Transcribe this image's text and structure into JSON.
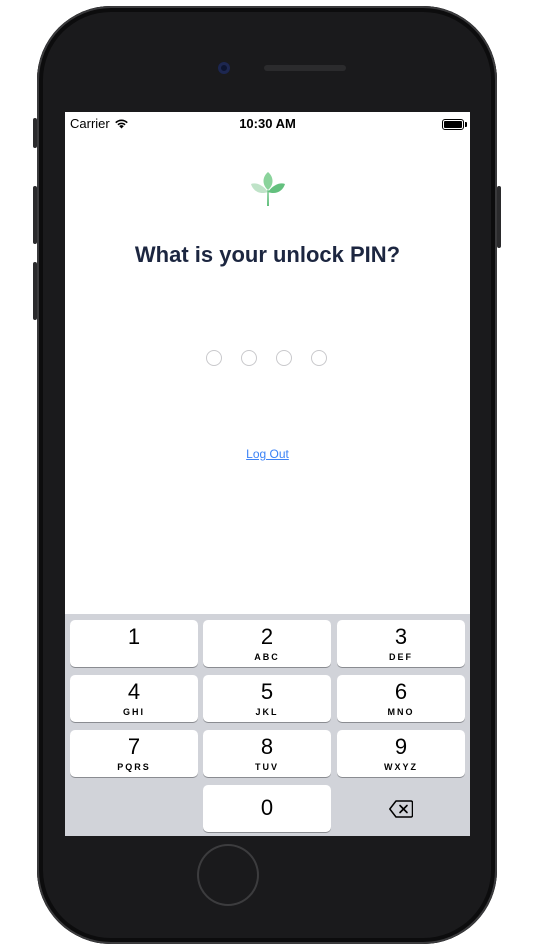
{
  "status_bar": {
    "carrier": "Carrier",
    "time": "10:30 AM",
    "icons": [
      "wifi-icon",
      "battery-icon"
    ]
  },
  "app": {
    "logo_icon": "leaf-icon",
    "title": "What is your unlock PIN?",
    "pin_length": 4,
    "logout_label": "Log Out",
    "colors": {
      "title": "#1c2640",
      "link": "#3b82f6",
      "logo_light": "#bfe3c8",
      "logo_dark": "#63c07e"
    }
  },
  "keypad": {
    "keys": [
      {
        "digit": "1",
        "letters": ""
      },
      {
        "digit": "2",
        "letters": "ABC"
      },
      {
        "digit": "3",
        "letters": "DEF"
      },
      {
        "digit": "4",
        "letters": "GHI"
      },
      {
        "digit": "5",
        "letters": "JKL"
      },
      {
        "digit": "6",
        "letters": "MNO"
      },
      {
        "digit": "7",
        "letters": "PQRS"
      },
      {
        "digit": "8",
        "letters": "TUV"
      },
      {
        "digit": "9",
        "letters": "WXYZ"
      }
    ],
    "zero": {
      "digit": "0"
    },
    "delete_icon": "backspace-icon"
  }
}
